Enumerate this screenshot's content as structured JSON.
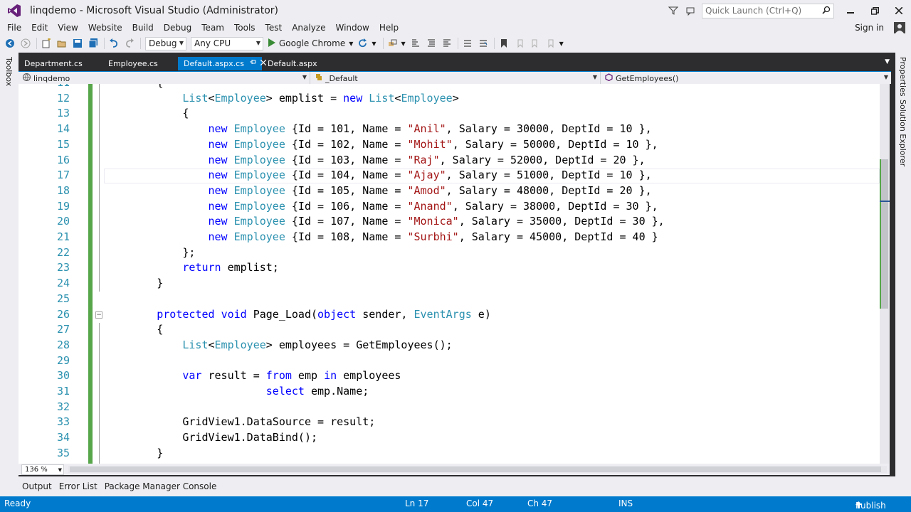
{
  "window": {
    "title": "linqdemo - Microsoft Visual Studio (Administrator)",
    "quick_launch_placeholder": "Quick Launch (Ctrl+Q)"
  },
  "menu": [
    "File",
    "Edit",
    "View",
    "Website",
    "Build",
    "Debug",
    "Team",
    "Tools",
    "Test",
    "Analyze",
    "Window",
    "Help"
  ],
  "sign_in": "Sign in",
  "toolbar": {
    "config": "Debug",
    "platform": "Any CPU",
    "run_target": "Google Chrome"
  },
  "side_panels": {
    "left": "Toolbox",
    "right_1": "Properties",
    "right_2": "Solution Explorer"
  },
  "tabs": [
    {
      "label": "Department.cs",
      "active": false
    },
    {
      "label": "Employee.cs",
      "active": false
    },
    {
      "label": "Default.aspx.cs",
      "active": true
    },
    {
      "label": "Default.aspx",
      "active": false
    }
  ],
  "navbar": {
    "project": "linqdemo",
    "class": "_Default",
    "member": "GetEmployees()"
  },
  "code_lines": [
    {
      "n": "11",
      "tokens": [
        [
          "p",
          "        {"
        ]
      ]
    },
    {
      "n": "12",
      "tokens": [
        [
          "p",
          "            "
        ],
        [
          "t",
          "List"
        ],
        [
          "p",
          "<"
        ],
        [
          "t",
          "Employee"
        ],
        [
          "p",
          "> emplist = "
        ],
        [
          "k",
          "new"
        ],
        [
          "p",
          " "
        ],
        [
          "t",
          "List"
        ],
        [
          "p",
          "<"
        ],
        [
          "t",
          "Employee"
        ],
        [
          "p",
          ">"
        ]
      ]
    },
    {
      "n": "13",
      "tokens": [
        [
          "p",
          "            {"
        ]
      ]
    },
    {
      "n": "14",
      "tokens": [
        [
          "p",
          "                "
        ],
        [
          "k",
          "new"
        ],
        [
          "p",
          " "
        ],
        [
          "t",
          "Employee"
        ],
        [
          "p",
          " {Id = 101, Name = "
        ],
        [
          "s",
          "\"Anil\""
        ],
        [
          "p",
          ", Salary = 30000, DeptId = 10 },"
        ]
      ]
    },
    {
      "n": "15",
      "tokens": [
        [
          "p",
          "                "
        ],
        [
          "k",
          "new"
        ],
        [
          "p",
          " "
        ],
        [
          "t",
          "Employee"
        ],
        [
          "p",
          " {Id = 102, Name = "
        ],
        [
          "s",
          "\"Mohit\""
        ],
        [
          "p",
          ", Salary = 50000, DeptId = 10 },"
        ]
      ]
    },
    {
      "n": "16",
      "tokens": [
        [
          "p",
          "                "
        ],
        [
          "k",
          "new"
        ],
        [
          "p",
          " "
        ],
        [
          "t",
          "Employee"
        ],
        [
          "p",
          " {Id = 103, Name = "
        ],
        [
          "s",
          "\"Raj\""
        ],
        [
          "p",
          ", Salary = 52000, DeptId = 20 },"
        ]
      ]
    },
    {
      "n": "17",
      "tokens": [
        [
          "p",
          "                "
        ],
        [
          "k",
          "new"
        ],
        [
          "p",
          " "
        ],
        [
          "t",
          "Employee"
        ],
        [
          "p",
          " {Id = 104, Name = "
        ],
        [
          "s",
          "\"Ajay\""
        ],
        [
          "p",
          ", Salary = 51000, DeptId = 10 },"
        ]
      ]
    },
    {
      "n": "18",
      "tokens": [
        [
          "p",
          "                "
        ],
        [
          "k",
          "new"
        ],
        [
          "p",
          " "
        ],
        [
          "t",
          "Employee"
        ],
        [
          "p",
          " {Id = 105, Name = "
        ],
        [
          "s",
          "\"Amod\""
        ],
        [
          "p",
          ", Salary = 48000, DeptId = 20 },"
        ]
      ]
    },
    {
      "n": "19",
      "tokens": [
        [
          "p",
          "                "
        ],
        [
          "k",
          "new"
        ],
        [
          "p",
          " "
        ],
        [
          "t",
          "Employee"
        ],
        [
          "p",
          " {Id = 106, Name = "
        ],
        [
          "s",
          "\"Anand\""
        ],
        [
          "p",
          ", Salary = 38000, DeptId = 30 },"
        ]
      ]
    },
    {
      "n": "20",
      "tokens": [
        [
          "p",
          "                "
        ],
        [
          "k",
          "new"
        ],
        [
          "p",
          " "
        ],
        [
          "t",
          "Employee"
        ],
        [
          "p",
          " {Id = 107, Name = "
        ],
        [
          "s",
          "\"Monica\""
        ],
        [
          "p",
          ", Salary = 35000, DeptId = 30 },"
        ]
      ]
    },
    {
      "n": "21",
      "tokens": [
        [
          "p",
          "                "
        ],
        [
          "k",
          "new"
        ],
        [
          "p",
          " "
        ],
        [
          "t",
          "Employee"
        ],
        [
          "p",
          " {Id = 108, Name = "
        ],
        [
          "s",
          "\"Surbhi\""
        ],
        [
          "p",
          ", Salary = 45000, DeptId = 40 }"
        ]
      ]
    },
    {
      "n": "22",
      "tokens": [
        [
          "p",
          "            };"
        ]
      ]
    },
    {
      "n": "23",
      "tokens": [
        [
          "p",
          "            "
        ],
        [
          "k",
          "return"
        ],
        [
          "p",
          " emplist;"
        ]
      ]
    },
    {
      "n": "24",
      "tokens": [
        [
          "p",
          "        }"
        ]
      ]
    },
    {
      "n": "25",
      "tokens": [
        [
          "p",
          ""
        ]
      ]
    },
    {
      "n": "26",
      "tokens": [
        [
          "p",
          "        "
        ],
        [
          "k",
          "protected"
        ],
        [
          "p",
          " "
        ],
        [
          "k",
          "void"
        ],
        [
          "p",
          " Page_Load("
        ],
        [
          "k",
          "object"
        ],
        [
          "p",
          " sender, "
        ],
        [
          "t",
          "EventArgs"
        ],
        [
          "p",
          " e)"
        ]
      ]
    },
    {
      "n": "27",
      "tokens": [
        [
          "p",
          "        {"
        ]
      ]
    },
    {
      "n": "28",
      "tokens": [
        [
          "p",
          "            "
        ],
        [
          "t",
          "List"
        ],
        [
          "p",
          "<"
        ],
        [
          "t",
          "Employee"
        ],
        [
          "p",
          "> employees = GetEmployees();"
        ]
      ]
    },
    {
      "n": "29",
      "tokens": [
        [
          "p",
          ""
        ]
      ]
    },
    {
      "n": "30",
      "tokens": [
        [
          "p",
          "            "
        ],
        [
          "k",
          "var"
        ],
        [
          "p",
          " result = "
        ],
        [
          "k",
          "from"
        ],
        [
          "p",
          " emp "
        ],
        [
          "k",
          "in"
        ],
        [
          "p",
          " employees"
        ]
      ]
    },
    {
      "n": "31",
      "tokens": [
        [
          "p",
          "                         "
        ],
        [
          "k",
          "select"
        ],
        [
          "p",
          " emp.Name;"
        ]
      ]
    },
    {
      "n": "32",
      "tokens": [
        [
          "p",
          ""
        ]
      ]
    },
    {
      "n": "33",
      "tokens": [
        [
          "p",
          "            GridView1.DataSource = result;"
        ]
      ]
    },
    {
      "n": "34",
      "tokens": [
        [
          "p",
          "            GridView1.DataBind();"
        ]
      ]
    },
    {
      "n": "35",
      "tokens": [
        [
          "p",
          "        }"
        ]
      ]
    }
  ],
  "zoom": "136 %",
  "bottom_tabs": [
    "Output",
    "Error List",
    "Package Manager Console"
  ],
  "status": {
    "ready": "Ready",
    "ln": "Ln 17",
    "col": "Col 47",
    "ch": "Ch 47",
    "mode": "INS",
    "publish": "Publish"
  },
  "colors": {
    "accent": "#007acc",
    "keyword": "#0000ff",
    "type": "#2b91af",
    "string": "#a31515",
    "change_marker": "#57a64a"
  }
}
